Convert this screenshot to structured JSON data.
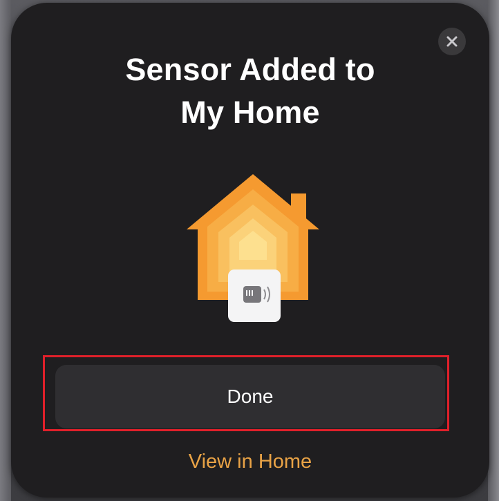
{
  "dialog": {
    "title_line1": "Sensor Added to",
    "title_line2": "My Home",
    "close_icon": "close-icon",
    "illustration_icon": "home-with-sensor-icon",
    "primary_button_label": "Done",
    "secondary_link_label": "View in Home"
  },
  "colors": {
    "sheet_background": "#1f1e20",
    "button_background": "#2f2e31",
    "link_accent": "#e9a346",
    "highlight_outline": "#e0202a",
    "house_orange": "#f5a033"
  }
}
